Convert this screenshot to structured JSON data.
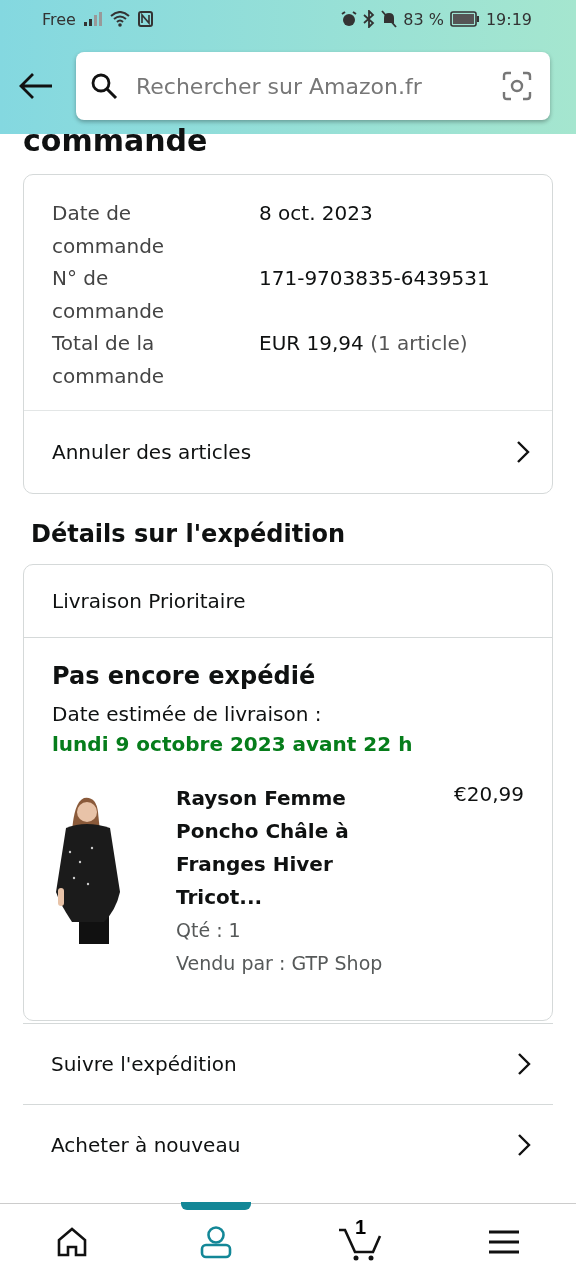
{
  "status_bar": {
    "carrier": "Free",
    "battery": "83 %",
    "time": "19:19"
  },
  "search": {
    "placeholder": "Rechercher sur Amazon.fr"
  },
  "page_heading": "commande",
  "order_summary": {
    "rows": [
      {
        "label": "Date de commande",
        "value": "8 oct. 2023"
      },
      {
        "label": "N° de commande",
        "value": "171-9703835-6439531"
      },
      {
        "label": "Total de la commande",
        "value": "EUR 19,94",
        "note": "(1 article)"
      }
    ],
    "action": "Annuler des articles"
  },
  "shipment_heading": "Détails sur l'expédition",
  "shipment": {
    "method": "Livraison Prioritaire",
    "status": "Pas encore expédié",
    "estimate_label": "Date estimée de livraison :",
    "estimate_date": "lundi 9 octobre 2023 avant 22 h",
    "item": {
      "title": "Rayson Femme Poncho Châle à Franges Hiver Tricot...",
      "price": "€20,99",
      "quantity": "Qté : 1",
      "seller": "Vendu par : GTP Shop"
    }
  },
  "actions": [
    "Suivre l'expédition",
    "Acheter à nouveau"
  ],
  "bottom_nav": [
    {
      "kind": "home",
      "selected": false
    },
    {
      "kind": "account",
      "selected": true
    },
    {
      "kind": "cart",
      "selected": false,
      "count": "1"
    },
    {
      "kind": "menu",
      "selected": false
    }
  ]
}
